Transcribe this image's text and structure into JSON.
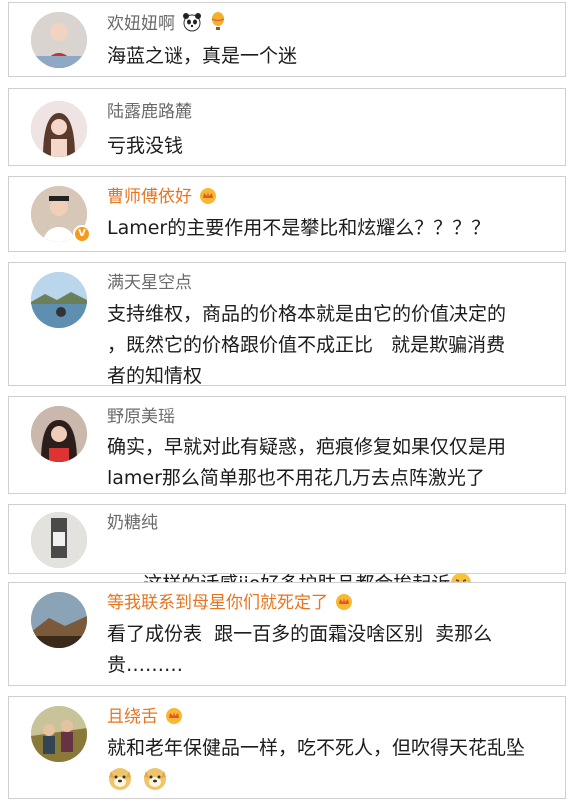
{
  "comments": [
    {
      "user": "欢妞妞啊",
      "text": "海蓝之谜，真是一个迷",
      "user_icons": [
        "panda-emoji-icon",
        "balloon-emoji-icon"
      ]
    },
    {
      "user": "陆露鹿路麓",
      "text": "亏我没钱"
    },
    {
      "user": "曹师傅依好",
      "text": "Lamer的主要作用不是攀比和炫耀么？？？？",
      "user_icons": [
        "vip-crown-icon"
      ],
      "verified": true
    },
    {
      "user": "满天星空点",
      "text": "支持维权，商品的价格本就是由它的价值决定的\n，既然它的价格跟价值不成正比   就是欺骗消费\n者的知情权"
    },
    {
      "user": "野原美瑶",
      "text": "确实，早就对此有疑惑，疤痕修复如果仅仅是用\nlamer那么简单那也不用花几万去点阵激光了"
    },
    {
      "user": "奶糖纯",
      "text": "这样的话感jio好多护肤品都会挨起诉",
      "text_icons": [
        "laughing-tears-emoji-icon"
      ]
    },
    {
      "user": "等我联系到母星你们就死定了",
      "text": "看了成份表  跟一百多的面霜没啥区别  卖那么\n贵………",
      "user_icons": [
        "vip-crown-icon"
      ]
    },
    {
      "user": "且绕舌",
      "text": "就和老年保健品一样，吃不死人，但吹得天花乱坠",
      "user_icons": [
        "vip-crown-icon"
      ],
      "text_icons": [
        "doge-emoji-icon",
        "doge-emoji-icon"
      ]
    }
  ],
  "colors": {
    "vip_name": "#e8741d",
    "name": "#6a6a6a",
    "text": "#1c1c1c",
    "border": "#cfcfcf",
    "badge": "#f39a1f"
  }
}
